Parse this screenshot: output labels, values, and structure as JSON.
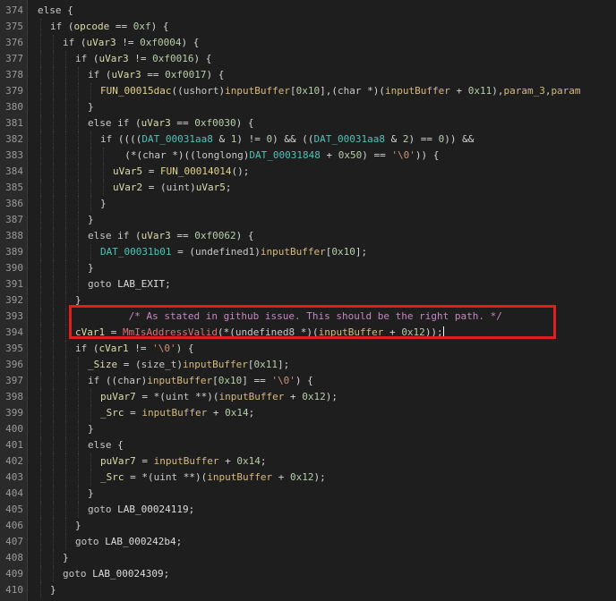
{
  "editor": {
    "highlight": {
      "color": "#e01e1e",
      "from_line": "393",
      "to_line": "394"
    },
    "lines": [
      {
        "no": "374",
        "indent": 1,
        "tokens": [
          [
            "kw",
            "else"
          ],
          [
            "op",
            " {"
          ]
        ]
      },
      {
        "no": "375",
        "indent": 2,
        "tokens": [
          [
            "kw",
            "if"
          ],
          [
            "op",
            " ("
          ],
          [
            "var",
            "opcode"
          ],
          [
            "op",
            " == "
          ],
          [
            "num",
            "0xf"
          ],
          [
            "op",
            ") {"
          ]
        ]
      },
      {
        "no": "376",
        "indent": 3,
        "tokens": [
          [
            "kw",
            "if"
          ],
          [
            "op",
            " ("
          ],
          [
            "var",
            "uVar3"
          ],
          [
            "op",
            " != "
          ],
          [
            "num",
            "0xf0004"
          ],
          [
            "op",
            ") {"
          ]
        ]
      },
      {
        "no": "377",
        "indent": 4,
        "tokens": [
          [
            "kw",
            "if"
          ],
          [
            "op",
            " ("
          ],
          [
            "var",
            "uVar3"
          ],
          [
            "op",
            " != "
          ],
          [
            "num",
            "0xf0016"
          ],
          [
            "op",
            ") {"
          ]
        ]
      },
      {
        "no": "378",
        "indent": 5,
        "tokens": [
          [
            "kw",
            "if"
          ],
          [
            "op",
            " ("
          ],
          [
            "var",
            "uVar3"
          ],
          [
            "op",
            " == "
          ],
          [
            "num",
            "0xf0017"
          ],
          [
            "op",
            ") {"
          ]
        ]
      },
      {
        "no": "379",
        "indent": 6,
        "tokens": [
          [
            "fn",
            "FUN_00015dac"
          ],
          [
            "op",
            "(("
          ],
          [
            "type",
            "ushort"
          ],
          [
            "op",
            ")"
          ],
          [
            "param",
            "inputBuffer"
          ],
          [
            "op",
            "["
          ],
          [
            "num",
            "0x10"
          ],
          [
            "op",
            "],("
          ],
          [
            "type",
            "char"
          ],
          [
            "op",
            " *)("
          ],
          [
            "param",
            "inputBuffer"
          ],
          [
            "op",
            " + "
          ],
          [
            "num",
            "0x11"
          ],
          [
            "op",
            "),"
          ],
          [
            "param",
            "param_3"
          ],
          [
            "op",
            ","
          ],
          [
            "param",
            "param"
          ]
        ]
      },
      {
        "no": "380",
        "indent": 5,
        "tokens": [
          [
            "op",
            "}"
          ]
        ]
      },
      {
        "no": "381",
        "indent": 5,
        "tokens": [
          [
            "kw",
            "else if"
          ],
          [
            "op",
            " ("
          ],
          [
            "var",
            "uVar3"
          ],
          [
            "op",
            " == "
          ],
          [
            "num",
            "0xf0030"
          ],
          [
            "op",
            ") {"
          ]
        ]
      },
      {
        "no": "382",
        "indent": 6,
        "tokens": [
          [
            "kw",
            "if"
          ],
          [
            "op",
            " (((("
          ],
          [
            "global",
            "DAT_00031aa8"
          ],
          [
            "op",
            " & "
          ],
          [
            "num",
            "1"
          ],
          [
            "op",
            ") != "
          ],
          [
            "num",
            "0"
          ],
          [
            "op",
            ") && (("
          ],
          [
            "global",
            "DAT_00031aa8"
          ],
          [
            "op",
            " & "
          ],
          [
            "num",
            "2"
          ],
          [
            "op",
            ") == "
          ],
          [
            "num",
            "0"
          ],
          [
            "op",
            ")) &&"
          ]
        ]
      },
      {
        "no": "383",
        "indent": 7,
        "tokens": [
          [
            "op",
            "  (*("
          ],
          [
            "type",
            "char"
          ],
          [
            "op",
            " *)(("
          ],
          [
            "type",
            "longlong"
          ],
          [
            "op",
            ")"
          ],
          [
            "global",
            "DAT_00031848"
          ],
          [
            "op",
            " + "
          ],
          [
            "num",
            "0x50"
          ],
          [
            "op",
            ") == "
          ],
          [
            "str",
            "'\\0'"
          ],
          [
            "op",
            ")) {"
          ]
        ]
      },
      {
        "no": "384",
        "indent": 7,
        "tokens": [
          [
            "var",
            "uVar5"
          ],
          [
            "op",
            " = "
          ],
          [
            "fn",
            "FUN_00014014"
          ],
          [
            "op",
            "();"
          ]
        ]
      },
      {
        "no": "385",
        "indent": 7,
        "tokens": [
          [
            "var",
            "uVar2"
          ],
          [
            "op",
            " = ("
          ],
          [
            "type",
            "uint"
          ],
          [
            "op",
            ")"
          ],
          [
            "var",
            "uVar5"
          ],
          [
            "op",
            ";"
          ]
        ]
      },
      {
        "no": "386",
        "indent": 6,
        "tokens": [
          [
            "op",
            "}"
          ]
        ]
      },
      {
        "no": "387",
        "indent": 5,
        "tokens": [
          [
            "op",
            "}"
          ]
        ]
      },
      {
        "no": "388",
        "indent": 5,
        "tokens": [
          [
            "kw",
            "else if"
          ],
          [
            "op",
            " ("
          ],
          [
            "var",
            "uVar3"
          ],
          [
            "op",
            " == "
          ],
          [
            "num",
            "0xf0062"
          ],
          [
            "op",
            ") {"
          ]
        ]
      },
      {
        "no": "389",
        "indent": 6,
        "tokens": [
          [
            "global",
            "DAT_00031b01"
          ],
          [
            "op",
            " = ("
          ],
          [
            "type",
            "undefined1"
          ],
          [
            "op",
            ")"
          ],
          [
            "param",
            "inputBuffer"
          ],
          [
            "op",
            "["
          ],
          [
            "num",
            "0x10"
          ],
          [
            "op",
            "];"
          ]
        ]
      },
      {
        "no": "390",
        "indent": 5,
        "tokens": [
          [
            "op",
            "}"
          ]
        ]
      },
      {
        "no": "391",
        "indent": 5,
        "tokens": [
          [
            "kw",
            "goto"
          ],
          [
            "op",
            " "
          ],
          [
            "text",
            "LAB_EXIT"
          ],
          [
            "op",
            ";"
          ]
        ]
      },
      {
        "no": "392",
        "indent": 4,
        "tokens": [
          [
            "op",
            "}"
          ]
        ]
      },
      {
        "no": "393",
        "indent": 4,
        "tokens": [
          [
            "comment",
            "         /* As stated in github issue. This should be the right path. */"
          ]
        ]
      },
      {
        "no": "394",
        "indent": 4,
        "cursor": true,
        "tokens": [
          [
            "var",
            "cVar1"
          ],
          [
            "op",
            " = "
          ],
          [
            "api",
            "MmIsAddressValid"
          ],
          [
            "op",
            "(*("
          ],
          [
            "type",
            "undefined8"
          ],
          [
            "op",
            " *)("
          ],
          [
            "param",
            "inputBuffer"
          ],
          [
            "op",
            " + "
          ],
          [
            "num",
            "0x12"
          ],
          [
            "op",
            "));"
          ]
        ]
      },
      {
        "no": "395",
        "indent": 4,
        "tokens": [
          [
            "kw",
            "if"
          ],
          [
            "op",
            " ("
          ],
          [
            "var",
            "cVar1"
          ],
          [
            "op",
            " != "
          ],
          [
            "str",
            "'\\0'"
          ],
          [
            "op",
            ") {"
          ]
        ]
      },
      {
        "no": "396",
        "indent": 5,
        "tokens": [
          [
            "var",
            "_Size"
          ],
          [
            "op",
            " = ("
          ],
          [
            "type",
            "size_t"
          ],
          [
            "op",
            ")"
          ],
          [
            "param",
            "inputBuffer"
          ],
          [
            "op",
            "["
          ],
          [
            "num",
            "0x11"
          ],
          [
            "op",
            "];"
          ]
        ]
      },
      {
        "no": "397",
        "indent": 5,
        "tokens": [
          [
            "kw",
            "if"
          ],
          [
            "op",
            " (("
          ],
          [
            "type",
            "char"
          ],
          [
            "op",
            ")"
          ],
          [
            "param",
            "inputBuffer"
          ],
          [
            "op",
            "["
          ],
          [
            "num",
            "0x10"
          ],
          [
            "op",
            "] == "
          ],
          [
            "str",
            "'\\0'"
          ],
          [
            "op",
            ") {"
          ]
        ]
      },
      {
        "no": "398",
        "indent": 6,
        "tokens": [
          [
            "var",
            "puVar7"
          ],
          [
            "op",
            " = *("
          ],
          [
            "type",
            "uint"
          ],
          [
            "op",
            " **)("
          ],
          [
            "param",
            "inputBuffer"
          ],
          [
            "op",
            " + "
          ],
          [
            "num",
            "0x12"
          ],
          [
            "op",
            ");"
          ]
        ]
      },
      {
        "no": "399",
        "indent": 6,
        "tokens": [
          [
            "var",
            "_Src"
          ],
          [
            "op",
            " = "
          ],
          [
            "param",
            "inputBuffer"
          ],
          [
            "op",
            " + "
          ],
          [
            "num",
            "0x14"
          ],
          [
            "op",
            ";"
          ]
        ]
      },
      {
        "no": "400",
        "indent": 5,
        "tokens": [
          [
            "op",
            "}"
          ]
        ]
      },
      {
        "no": "401",
        "indent": 5,
        "tokens": [
          [
            "kw",
            "else"
          ],
          [
            "op",
            " {"
          ]
        ]
      },
      {
        "no": "402",
        "indent": 6,
        "tokens": [
          [
            "var",
            "puVar7"
          ],
          [
            "op",
            " = "
          ],
          [
            "param",
            "inputBuffer"
          ],
          [
            "op",
            " + "
          ],
          [
            "num",
            "0x14"
          ],
          [
            "op",
            ";"
          ]
        ]
      },
      {
        "no": "403",
        "indent": 6,
        "tokens": [
          [
            "var",
            "_Src"
          ],
          [
            "op",
            " = *("
          ],
          [
            "type",
            "uint"
          ],
          [
            "op",
            " **)("
          ],
          [
            "param",
            "inputBuffer"
          ],
          [
            "op",
            " + "
          ],
          [
            "num",
            "0x12"
          ],
          [
            "op",
            ");"
          ]
        ]
      },
      {
        "no": "404",
        "indent": 5,
        "tokens": [
          [
            "op",
            "}"
          ]
        ]
      },
      {
        "no": "405",
        "indent": 5,
        "tokens": [
          [
            "kw",
            "goto"
          ],
          [
            "op",
            " "
          ],
          [
            "text",
            "LAB_00024119"
          ],
          [
            "op",
            ";"
          ]
        ]
      },
      {
        "no": "406",
        "indent": 4,
        "tokens": [
          [
            "op",
            "}"
          ]
        ]
      },
      {
        "no": "407",
        "indent": 4,
        "tokens": [
          [
            "kw",
            "goto"
          ],
          [
            "op",
            " "
          ],
          [
            "text",
            "LAB_000242b4"
          ],
          [
            "op",
            ";"
          ]
        ]
      },
      {
        "no": "408",
        "indent": 3,
        "tokens": [
          [
            "op",
            "}"
          ]
        ]
      },
      {
        "no": "409",
        "indent": 3,
        "tokens": [
          [
            "kw",
            "goto"
          ],
          [
            "op",
            " "
          ],
          [
            "text",
            "LAB_00024309"
          ],
          [
            "op",
            ";"
          ]
        ]
      },
      {
        "no": "410",
        "indent": 2,
        "tokens": [
          [
            "op",
            "}"
          ]
        ]
      }
    ]
  }
}
